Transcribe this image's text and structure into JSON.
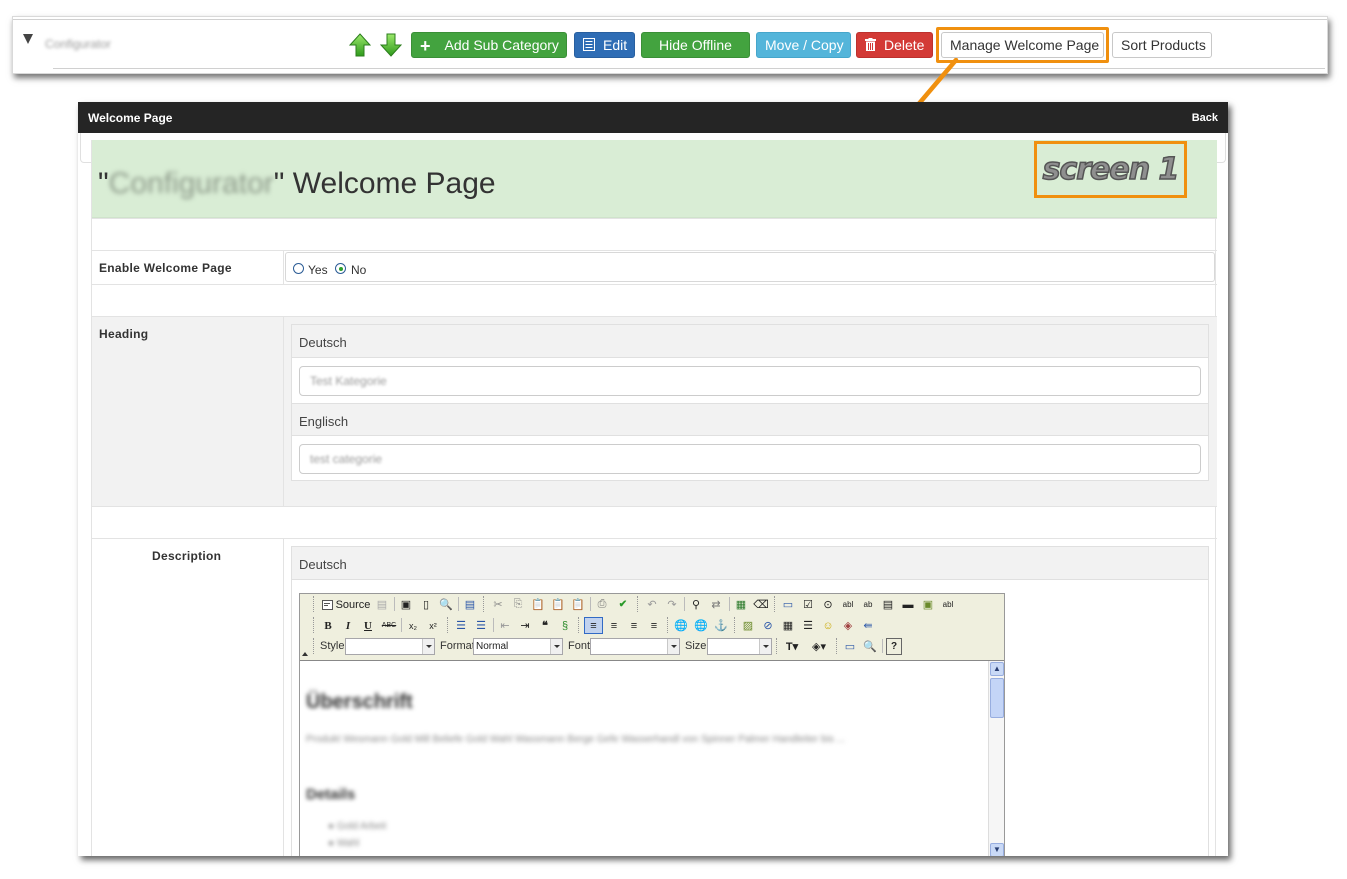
{
  "category_row": {
    "name": "Configurator",
    "buttons": {
      "move_up": "Move up",
      "move_down": "Move down",
      "add_sub_category": "Add Sub Category",
      "edit": "Edit",
      "hide_offline": "Hide Offline",
      "move_copy": "Move / Copy",
      "delete": "Delete",
      "manage_welcome_page": "Manage Welcome Page",
      "sort_products": "Sort Products"
    }
  },
  "annotation": {
    "label": "screen 1",
    "color": "#f0900f"
  },
  "panel": {
    "title": "Welcome Page",
    "back": "Back",
    "hero": {
      "quote_open": "\"",
      "category_name": "Configurator",
      "suffix": "\" Welcome Page"
    },
    "enable": {
      "label": "Enable Welcome Page",
      "options": [
        "Yes",
        "No"
      ],
      "selected": "No"
    },
    "heading": {
      "label": "Heading",
      "languages": [
        {
          "name": "Deutsch",
          "value": "Test Kategorie"
        },
        {
          "name": "Englisch",
          "value": "test categorie"
        }
      ]
    },
    "description": {
      "label": "Description",
      "language": "Deutsch",
      "toolbar": {
        "source": "Source",
        "style_label": "Style",
        "style_value": "",
        "format_label": "Format",
        "format_value": "Normal",
        "font_label": "Font",
        "font_value": "",
        "size_label": "Size",
        "size_value": ""
      },
      "content": {
        "heading1": "Überschrift",
        "paragraph": "Produkt Wesmann Gold Mill Beliefe Gold Wahl Wassmann Berge Gefe Wasserhandl von Spinner Palmer Handleiter bis ...",
        "heading2": "Details",
        "list": [
          "Gold Arbeit",
          "Wahl"
        ]
      }
    }
  },
  "colors": {
    "green": "#43a33f",
    "blue": "#2f6db5",
    "cyan": "#54b5da",
    "red": "#d33a36",
    "hero_bg": "#d9edd5",
    "header_bg": "#252525"
  }
}
